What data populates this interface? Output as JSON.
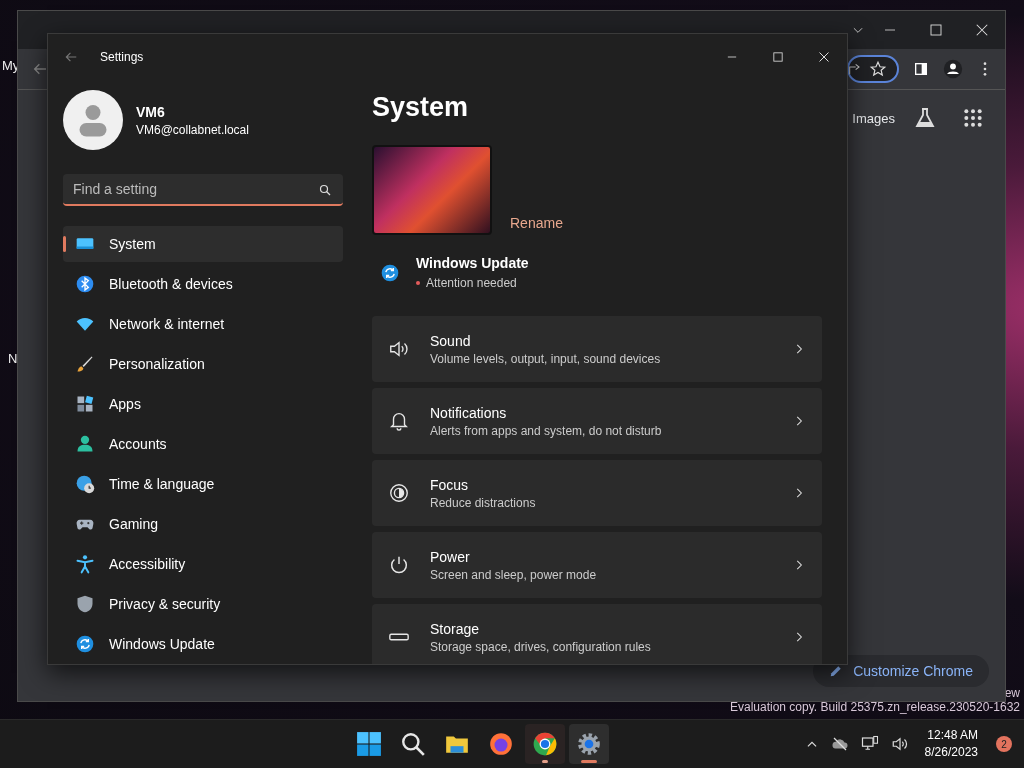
{
  "desktop": {
    "icon_labels": [
      "My",
      "N"
    ],
    "watermark": [
      "ew",
      "Evaluation copy. Build 25375.zn_release.230520-1632"
    ]
  },
  "browser": {
    "links": [
      "Images"
    ],
    "customize_button": "Customize Chrome"
  },
  "settings": {
    "title": "Settings",
    "user": {
      "name": "VM6",
      "email": "VM6@collabnet.local"
    },
    "search": {
      "placeholder": "Find a setting"
    },
    "nav": [
      {
        "label": "System",
        "kind": "system",
        "selected": true
      },
      {
        "label": "Bluetooth & devices",
        "kind": "bluetooth",
        "selected": false
      },
      {
        "label": "Network & internet",
        "kind": "network",
        "selected": false
      },
      {
        "label": "Personalization",
        "kind": "brush",
        "selected": false
      },
      {
        "label": "Apps",
        "kind": "apps",
        "selected": false
      },
      {
        "label": "Accounts",
        "kind": "accounts",
        "selected": false
      },
      {
        "label": "Time & language",
        "kind": "time",
        "selected": false
      },
      {
        "label": "Gaming",
        "kind": "gaming",
        "selected": false
      },
      {
        "label": "Accessibility",
        "kind": "accessibility",
        "selected": false
      },
      {
        "label": "Privacy & security",
        "kind": "privacy",
        "selected": false
      },
      {
        "label": "Windows Update",
        "kind": "update",
        "selected": false
      }
    ],
    "heading": "System",
    "rename": "Rename",
    "update": {
      "title": "Windows Update",
      "status": "Attention needed"
    },
    "cards": [
      {
        "kind": "sound",
        "title": "Sound",
        "subtitle": "Volume levels, output, input, sound devices"
      },
      {
        "kind": "notifications",
        "title": "Notifications",
        "subtitle": "Alerts from apps and system, do not disturb"
      },
      {
        "kind": "focus",
        "title": "Focus",
        "subtitle": "Reduce distractions"
      },
      {
        "kind": "power",
        "title": "Power",
        "subtitle": "Screen and sleep, power mode"
      },
      {
        "kind": "storage",
        "title": "Storage",
        "subtitle": "Storage space, drives, configuration rules"
      }
    ]
  },
  "taskbar": {
    "apps": [
      {
        "kind": "start",
        "running": false,
        "selected": false
      },
      {
        "kind": "search",
        "running": false,
        "selected": false
      },
      {
        "kind": "explorer",
        "running": false,
        "selected": false
      },
      {
        "kind": "firefox",
        "running": false,
        "selected": false
      },
      {
        "kind": "chrome",
        "running": true,
        "selected": false
      },
      {
        "kind": "settings",
        "running": true,
        "selected": true
      }
    ],
    "time": "12:48 AM",
    "date": "8/26/2023",
    "badge": "2"
  }
}
